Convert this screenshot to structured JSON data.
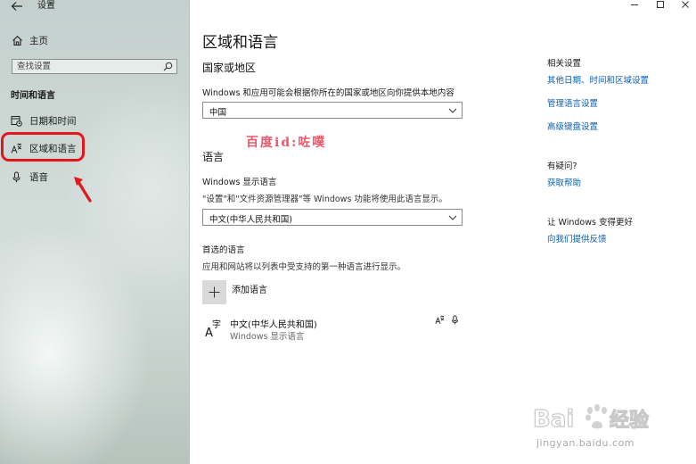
{
  "window": {
    "title": "设置",
    "back_icon": "arrow-left-icon",
    "controls": [
      "minimize-icon",
      "maximize-icon",
      "close-icon"
    ]
  },
  "sidebar": {
    "home_label": "主页",
    "search_placeholder": "查找设置",
    "section_title": "时间和语言",
    "items": [
      {
        "label": "日期和时间",
        "icon": "clock-calendar-icon"
      },
      {
        "label": "区域和语言",
        "icon": "region-language-icon",
        "selected": true
      },
      {
        "label": "语音",
        "icon": "microphone-icon"
      }
    ]
  },
  "main": {
    "page_title": "区域和语言",
    "country_section": {
      "heading": "国家或地区",
      "description": "Windows 和应用可能会根据你所在的国家或地区向你提供本地内容",
      "selected": "中国"
    },
    "language_section": {
      "heading": "语言",
      "display_language_label": "Windows 显示语言",
      "display_language_desc": "\"设置\"和\"文件资源管理器\"等 Windows 功能将使用此语言显示。",
      "display_language_selected": "中文(中华人民共和国)",
      "preferred_label": "首选的语言",
      "preferred_desc": "应用和网站将以列表中受支持的第一种语言进行显示。",
      "add_language_label": "添加语言",
      "languages": [
        {
          "name": "中文(中华人民共和国)",
          "subtitle": "Windows 显示语言",
          "icon": "language-a-zi-icon"
        }
      ]
    }
  },
  "right_panel": {
    "related_heading": "相关设置",
    "related_links": [
      "其他日期、时间和区域设置",
      "管理语言设置",
      "高级键盘设置"
    ],
    "question_heading": "有疑问?",
    "help_link": "获取帮助",
    "improve_heading": "让 Windows 变得更好",
    "feedback_link": "向我们提供反馈"
  },
  "overlay": {
    "watermark": "百度id:咗噗",
    "baidu_brand": "Bai du 经验",
    "baidu_url": "jingyan.baidu.com",
    "highlight_color": "#e3161b"
  }
}
